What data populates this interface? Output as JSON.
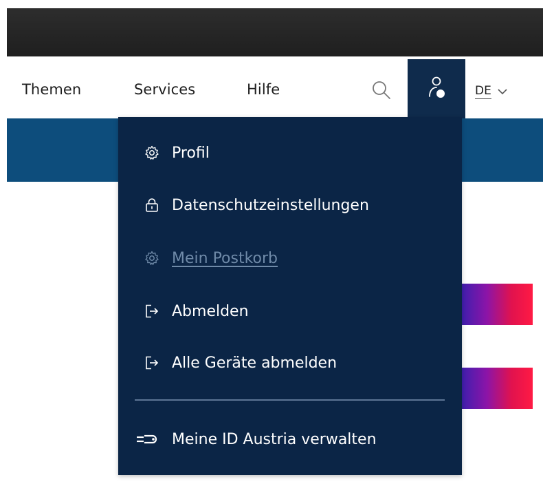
{
  "nav": {
    "items": [
      {
        "label": "Themen"
      },
      {
        "label": "Services"
      },
      {
        "label": "Hilfe"
      }
    ],
    "language": "DE"
  },
  "user_menu": {
    "items": [
      {
        "label": "Profil",
        "icon": "gear-icon"
      },
      {
        "label": "Datenschutzeinstellungen",
        "icon": "lock-icon"
      },
      {
        "label": "Mein Postkorb",
        "icon": "gear-icon",
        "state": "disabled"
      },
      {
        "label": "Abmelden",
        "icon": "logout-icon"
      },
      {
        "label": "Alle Geräte abmelden",
        "icon": "logout-icon"
      }
    ],
    "footer_item": {
      "label": "Meine ID Austria verwalten",
      "icon": "key-icon"
    }
  },
  "colors": {
    "menu_bg": "#0b2546",
    "band_blue": "#0d4d7c",
    "user_tab_bg": "#0f2b4c",
    "disabled_text": "#6f8aa8",
    "accent_gradient_start": "#3f1fae",
    "accent_gradient_end": "#ff1a44"
  }
}
